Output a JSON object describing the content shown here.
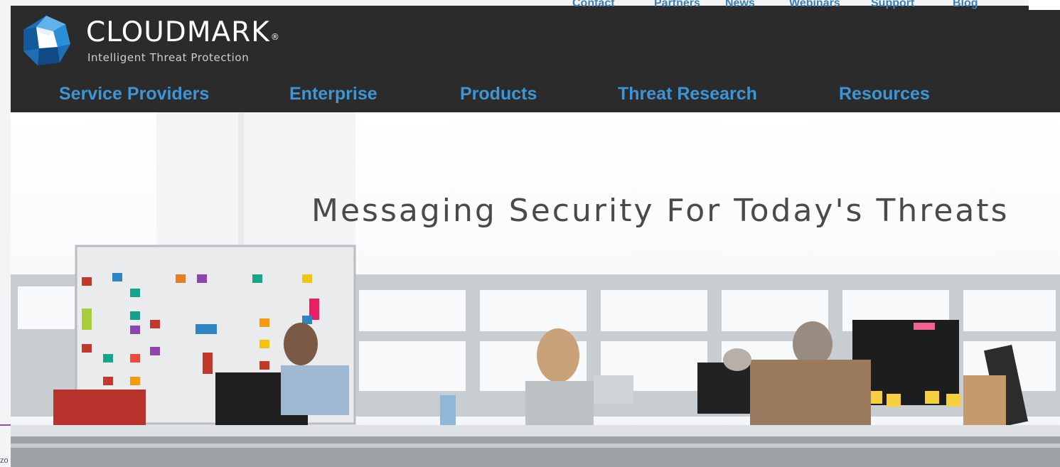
{
  "brand": {
    "name": "CLOUDMARK",
    "registered": "®",
    "tagline": "Intelligent Threat Protection"
  },
  "utility_nav": [
    "Contact",
    "Partners",
    "News",
    "Webinars",
    "Support",
    "Blog"
  ],
  "main_nav": [
    "Service Providers",
    "Enterprise",
    "Products",
    "Threat Research",
    "Resources"
  ],
  "hero": {
    "headline": "Messaging Security For Today's Threats"
  },
  "edge": {
    "fragment": "zo"
  },
  "colors": {
    "header_bg": "#2b2b2b",
    "nav_link": "#3d95d6",
    "headline": "#4a4a4a"
  }
}
